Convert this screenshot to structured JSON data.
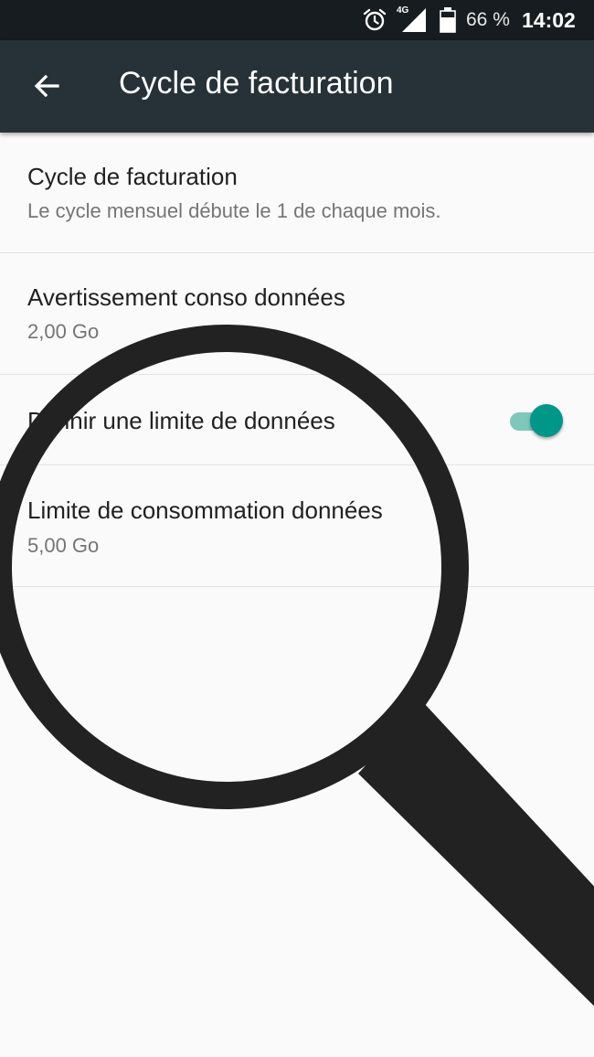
{
  "status_bar": {
    "network": "4G",
    "battery": "66 %",
    "time": "14:02"
  },
  "app_bar": {
    "title": "Cycle de facturation",
    "back_icon": "arrow-back-icon"
  },
  "settings": [
    {
      "title": "Cycle de facturation",
      "summary": "Le cycle mensuel débute le 1 de chaque mois."
    },
    {
      "title": "Avertissement conso données",
      "summary": "2,00 Go"
    },
    {
      "title": "Définir une limite de données",
      "toggle_on": true
    },
    {
      "title": "Limite de consommation données",
      "summary": "5,00 Go"
    }
  ],
  "colors": {
    "status_bar": "#161c1f",
    "app_bar": "#263238",
    "accent": "#009688",
    "magnifier": "#222222"
  }
}
